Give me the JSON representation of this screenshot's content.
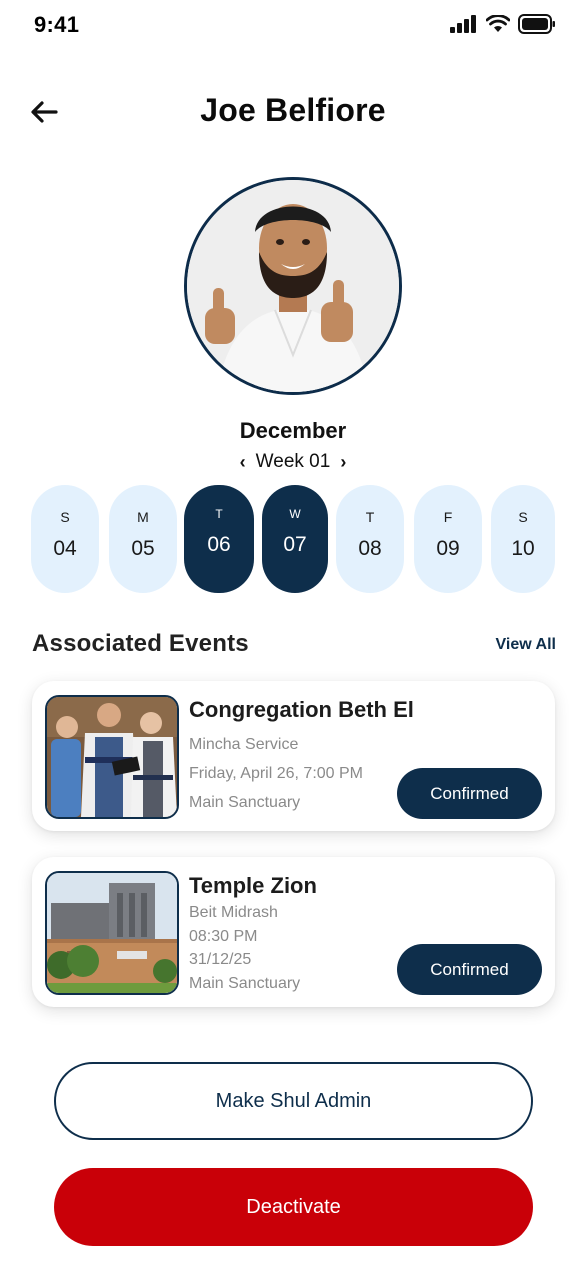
{
  "status_bar": {
    "time": "9:41"
  },
  "header": {
    "title": "Joe Belfiore"
  },
  "profile": {
    "avatar_icon": "user-photo"
  },
  "calendar": {
    "month": "December",
    "week_label": "Week 01",
    "prev_symbol": "‹",
    "next_symbol": "›",
    "days": [
      {
        "letter": "S",
        "number": "04",
        "selected": false
      },
      {
        "letter": "M",
        "number": "05",
        "selected": false
      },
      {
        "letter": "T",
        "number": "06",
        "selected": true
      },
      {
        "letter": "W",
        "number": "07",
        "selected": true
      },
      {
        "letter": "T",
        "number": "08",
        "selected": false
      },
      {
        "letter": "F",
        "number": "09",
        "selected": false
      },
      {
        "letter": "S",
        "number": "10",
        "selected": false
      }
    ]
  },
  "events_section": {
    "title": "Associated Events",
    "view_all": "View All",
    "events": [
      {
        "title": "Congregation Beth El",
        "service": "Mincha Service",
        "datetime": "Friday, April 26, 7:00 PM",
        "location": "Main Sanctuary",
        "status": "Confirmed"
      },
      {
        "title": "Temple Zion",
        "service": "Beit Midrash",
        "time": "08:30 PM",
        "date": "31/12/25",
        "location": "Main Sanctuary",
        "status": "Confirmed"
      }
    ]
  },
  "actions": {
    "make_admin": "Make Shul Admin",
    "deactivate": "Deactivate"
  },
  "colors": {
    "primary": "#0e2e4b",
    "day_pill": "#e3f1fd",
    "danger": "#c90008"
  }
}
